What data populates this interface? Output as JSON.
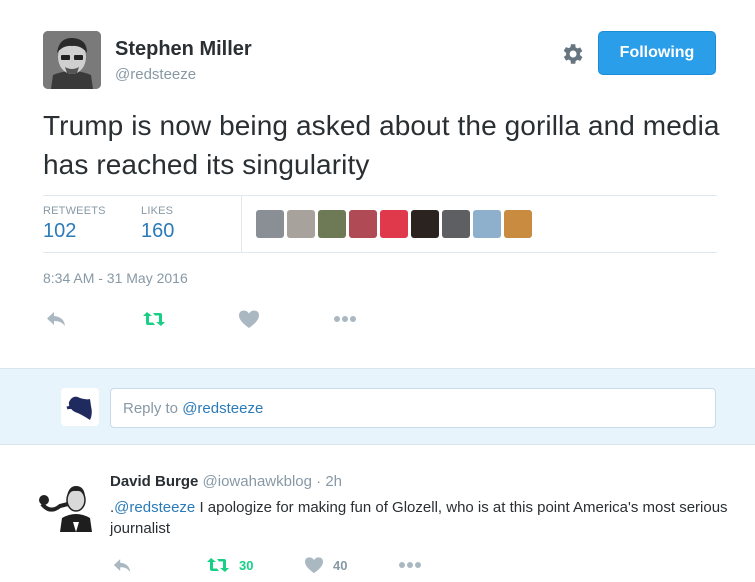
{
  "tweet": {
    "author_name": "Stephen Miller",
    "author_handle": "@redsteeze",
    "follow_label": "Following",
    "text": "Trump is now being asked about the gorilla and media has reached its singularity",
    "retweets_label": "RETWEETS",
    "retweets_count": "102",
    "likes_label": "LIKES",
    "likes_count": "160",
    "timestamp": "8:34 AM - 31 May 2016",
    "liker_colors": [
      "#8a8f96",
      "#a7a29c",
      "#6d7a55",
      "#b04a55",
      "#e0394c",
      "#2a2320",
      "#5d5f62",
      "#8fb0cc",
      "#c98b3f"
    ]
  },
  "reply_box": {
    "placeholder_prefix": "Reply to ",
    "placeholder_mention": "@redsteeze"
  },
  "reply": {
    "author_name": "David Burge",
    "author_handle": "@iowahawkblog",
    "separator": " · ",
    "time": "2h",
    "text_prefix": ".",
    "mention": "@redsteeze",
    "text": " I apologize for making fun of Glozell, who is at this point America's most serious journalist",
    "retweet_count": "30",
    "like_count": "40"
  },
  "colors": {
    "accent": "#2b9ee9",
    "link": "#2b7bb9",
    "muted": "#8899a6",
    "retweet_green": "#19cf86",
    "icon_grey": "#aab8c2"
  },
  "icons": {
    "settings": "gear-icon",
    "reply": "reply-icon",
    "retweet": "retweet-icon",
    "like": "heart-icon",
    "more": "more-icon"
  }
}
